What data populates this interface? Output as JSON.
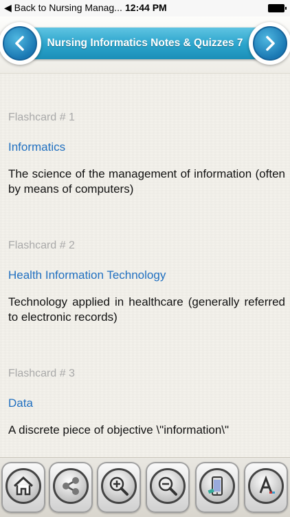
{
  "status_bar": {
    "back_label": "◀ Back to Nursing Manag...",
    "time": "12:44 PM"
  },
  "header": {
    "title": "Nursing Informatics Notes & Quizzes 7",
    "accent_color": "#2aa3cb"
  },
  "flashcards": [
    {
      "number": "Flashcard # 1",
      "term": "Informatics",
      "definition": "The science of the management of information (often by means of computers)"
    },
    {
      "number": "Flashcard # 2",
      "term": "Health Information Technology",
      "definition": "Technology applied in healthcare (generally referred to electronic records)"
    },
    {
      "number": "Flashcard # 3",
      "term": "Data",
      "definition": "A discrete piece of objective \\\"information\\\""
    }
  ],
  "toolbar": {
    "icons": [
      "home-icon",
      "share-icon",
      "zoom-in-icon",
      "zoom-out-icon",
      "device-icon",
      "font-icon"
    ]
  }
}
